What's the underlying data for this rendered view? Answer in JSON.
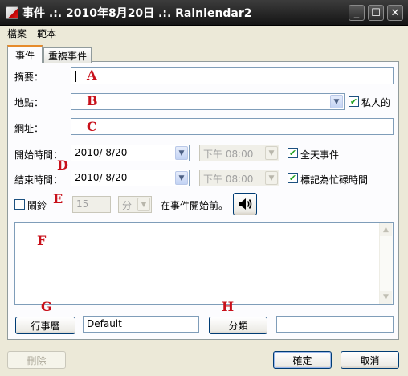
{
  "window": {
    "title": "事件 .:. 2010年8月20日 .:. Rainlendar2"
  },
  "menu": [
    "檔案",
    "範本"
  ],
  "tabs": [
    "事件",
    "重複事件"
  ],
  "form": {
    "summary_label": "摘要：",
    "location_label": "地點：",
    "url_label": "網址：",
    "private_label": "私人的",
    "start_label": "開始時間：",
    "end_label": "結束時間：",
    "start_date": "2010/  8/20",
    "start_time": "下午 08:00",
    "end_date": "2010/  8/20",
    "end_time": "下午 08:00",
    "all_day_label": "全天事件",
    "busy_label": "標記為忙碌時間",
    "alarm_label": "鬧鈴",
    "alarm_value": "15",
    "alarm_unit": "分",
    "alarm_suffix": "在事件開始前。",
    "calendar_button": "行事曆",
    "calendar_value": "Default",
    "category_button": "分類",
    "category_value": ""
  },
  "annotations": [
    "A",
    "B",
    "C",
    "D",
    "E",
    "F",
    "G",
    "H"
  ],
  "footer": {
    "delete": "刪除",
    "ok": "確定",
    "cancel": "取消"
  },
  "icons": {
    "window_controls": [
      "minimize-icon",
      "maximize-icon",
      "close-icon"
    ],
    "sound": "speaker-icon"
  }
}
